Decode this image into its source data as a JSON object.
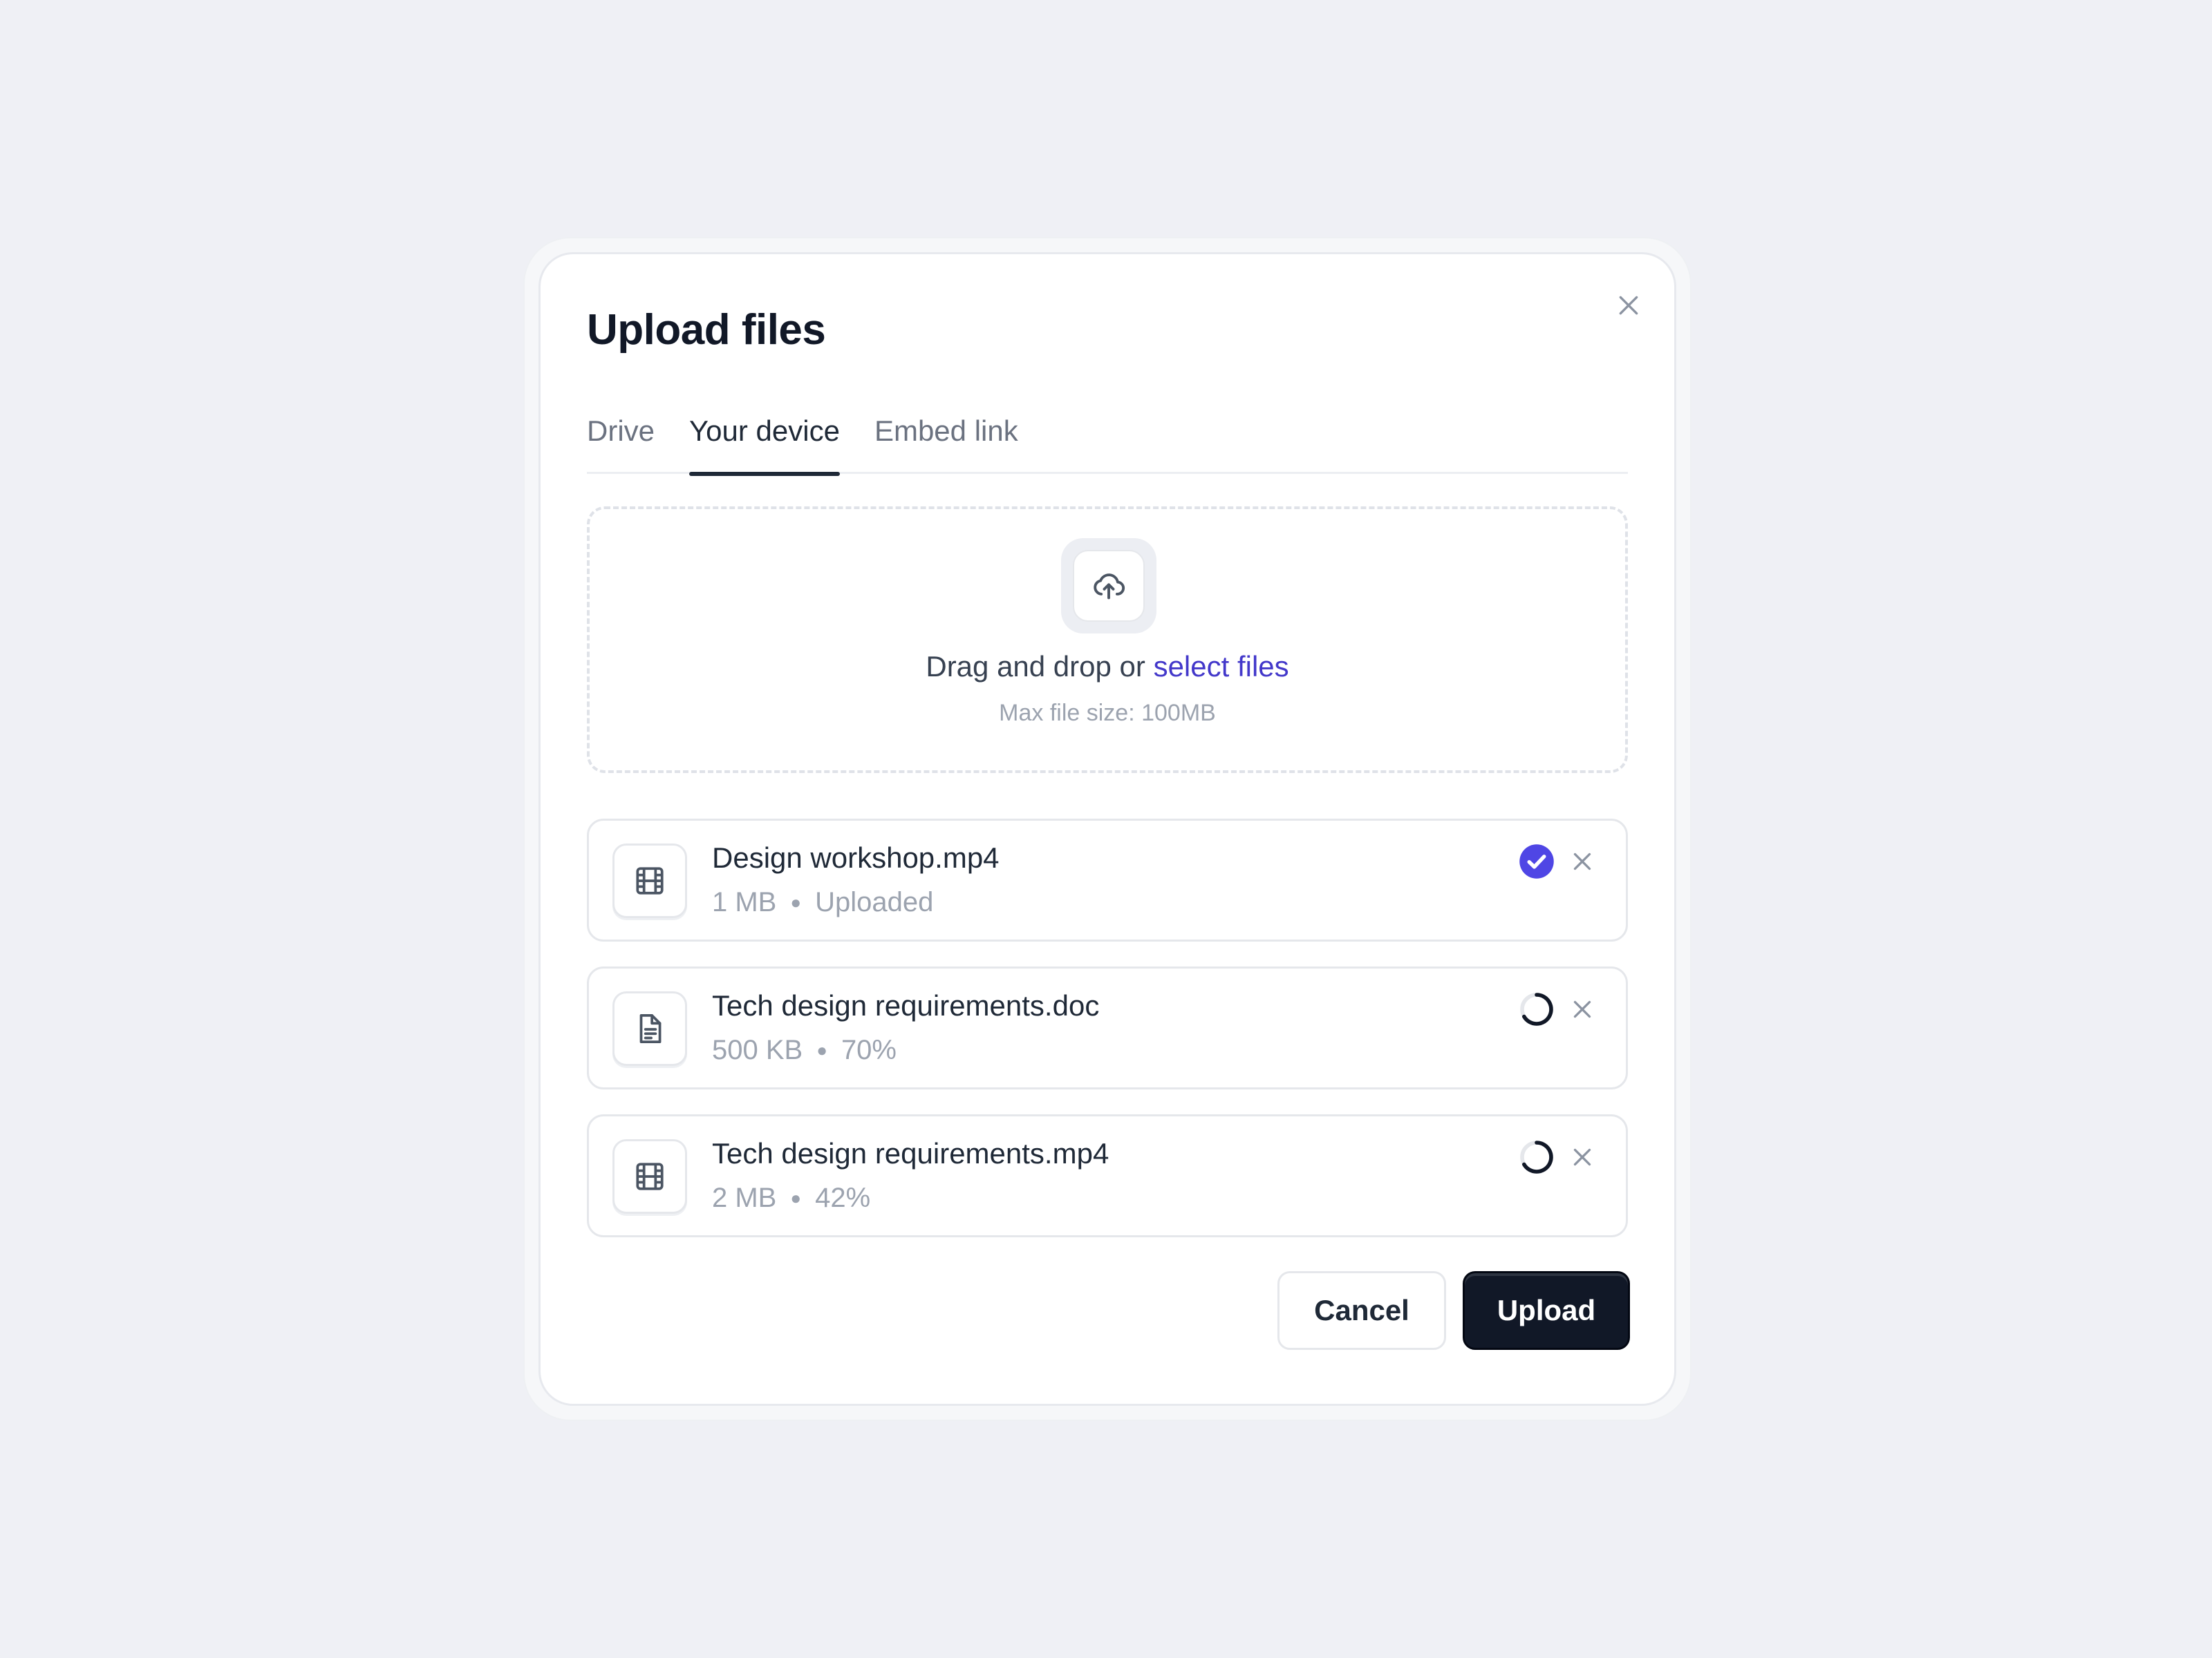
{
  "dialog": {
    "title": "Upload files"
  },
  "tabs": [
    {
      "label": "Drive",
      "active": false
    },
    {
      "label": "Your device",
      "active": true
    },
    {
      "label": "Embed link",
      "active": false
    }
  ],
  "dropzone": {
    "text_prefix": "Drag and drop or ",
    "link_text": "select files",
    "subtext": "Max file size: 100MB"
  },
  "files": [
    {
      "name": "Design workshop.mp4",
      "size": "1 MB",
      "status": "Uploaded",
      "icon": "film-icon",
      "state": "done"
    },
    {
      "name": "Tech design requirements.doc",
      "size": "500 KB",
      "status": "70%",
      "icon": "document-icon",
      "state": "uploading"
    },
    {
      "name": "Tech design requirements.mp4",
      "size": "2 MB",
      "status": "42%",
      "icon": "film-icon",
      "state": "uploading"
    }
  ],
  "actions": {
    "cancel_label": "Cancel",
    "upload_label": "Upload"
  },
  "colors": {
    "accent": "#4f46e5",
    "primary_button": "#111827",
    "link": "#4338ca"
  }
}
